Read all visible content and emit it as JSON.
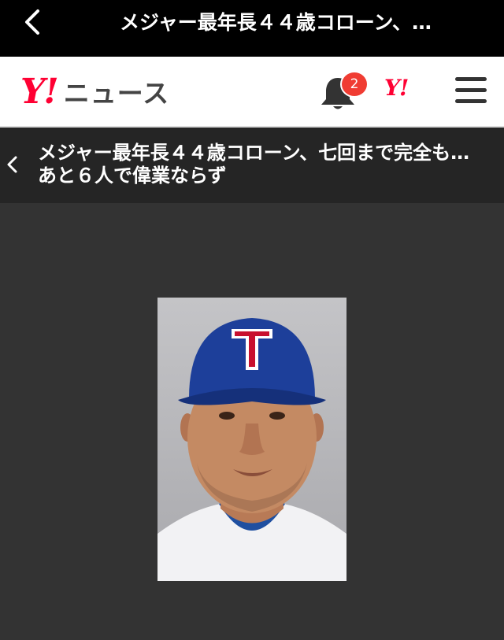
{
  "browser_bar": {
    "title": "メジャー最年長４４歳コローン、…"
  },
  "header": {
    "logo_y": "Y!",
    "logo_text": "ニュース",
    "notification_count": "2",
    "yahoo_link": "Y!"
  },
  "article": {
    "headline": "メジャー最年長４４歳コローン、七回まで完全も…　あと６人で偉業ならず"
  },
  "photo": {
    "cap_letter": "T"
  },
  "colors": {
    "yahoo_red": "#ff0033",
    "badge_red": "#f03c32",
    "background": "#333333",
    "subheader": "#252525"
  }
}
